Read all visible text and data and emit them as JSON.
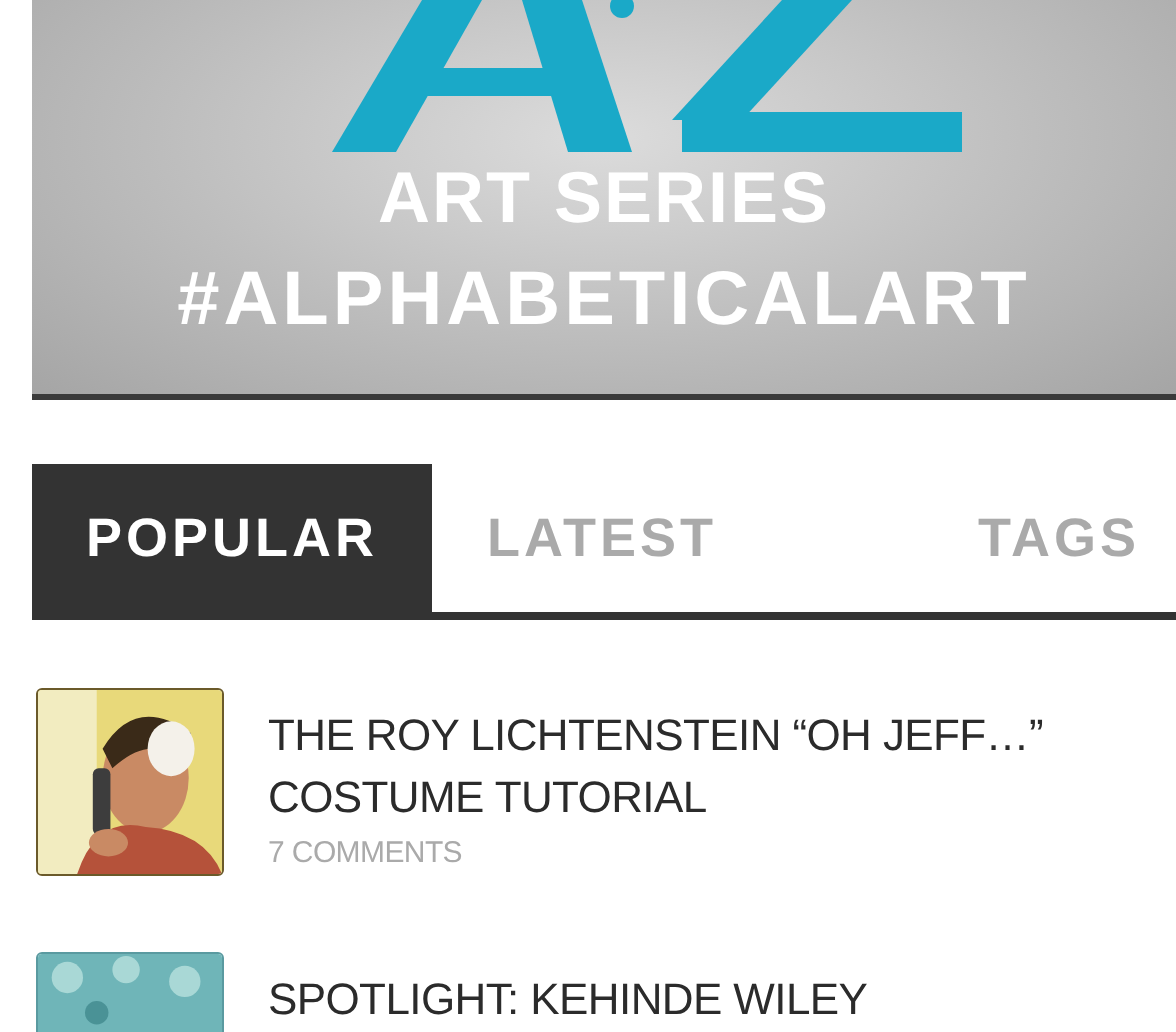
{
  "banner": {
    "kind": "graphic",
    "subtitle": "ART SERIES",
    "hashtag": "#ALPHABETICALART"
  },
  "tabs": [
    {
      "label": "POPULAR",
      "selected": true
    },
    {
      "label": "LATEST",
      "selected": false
    },
    {
      "label": "TAGS",
      "selected": false
    }
  ],
  "posts": [
    {
      "title": "THE ROY LICHTENSTEIN “OH JEFF…” COSTUME TUTORIAL",
      "comments": "7 COMMENTS"
    },
    {
      "title": "SPOTLIGHT: KEHINDE WILEY"
    }
  ]
}
